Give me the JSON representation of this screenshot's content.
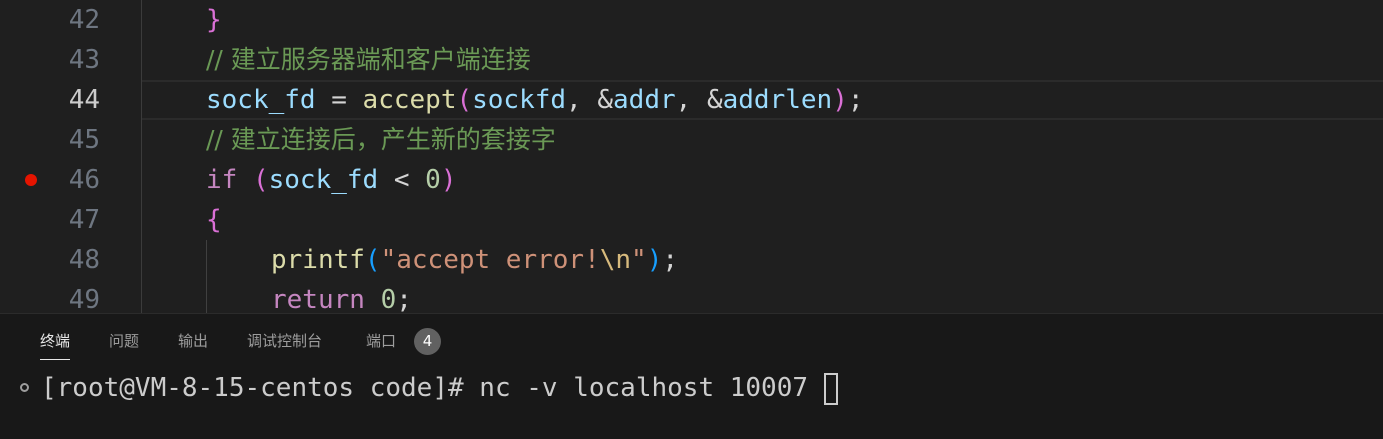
{
  "editor": {
    "lines": [
      {
        "num": "42",
        "text": "}"
      },
      {
        "num": "43",
        "text": "// 建立服务器端和客户端连接"
      },
      {
        "num": "44",
        "p1": "sock_fd",
        "p2": " = ",
        "p3": "accept",
        "p4": "(",
        "p5": "sockfd",
        "p6": ", &",
        "p7": "addr",
        "p8": ", &",
        "p9": "addrlen",
        "p10": ")",
        "p11": ";"
      },
      {
        "num": "45",
        "text": "// 建立连接后，产生新的套接字"
      },
      {
        "num": "46",
        "p1": "if",
        "p2": " ",
        "p3": "(",
        "p4": "sock_fd",
        "p5": " < ",
        "p6": "0",
        "p7": ")"
      },
      {
        "num": "47",
        "text": "{"
      },
      {
        "num": "48",
        "p1": "printf",
        "p2": "(",
        "p3": "\"accept error!",
        "p4": "\\n",
        "p5": "\"",
        "p6": ")",
        "p7": ";"
      },
      {
        "num": "49",
        "p1": "return",
        "p2": " ",
        "p3": "0",
        "p4": ";"
      }
    ],
    "breakpoint_line": "46",
    "active_line": "44"
  },
  "panel": {
    "tabs": [
      "终端",
      "问题",
      "输出",
      "调试控制台",
      "端口"
    ],
    "ports_badge": "4",
    "terminal_prompt": "[root@VM-8-15-centos code]# nc -v localhost 10007"
  },
  "colors": {
    "background": "#1f1f1f",
    "comment": "#6a9955",
    "keyword": "#c586c0",
    "variable": "#9cdcfe",
    "function": "#dcdcaa",
    "number": "#b5cea8",
    "string": "#ce9178",
    "breakpoint": "#e51400"
  }
}
